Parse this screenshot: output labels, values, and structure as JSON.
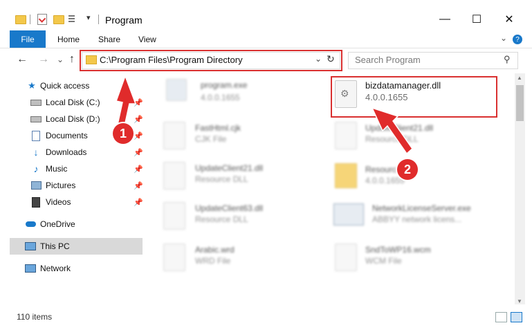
{
  "window": {
    "title": "Program",
    "minimize_glyph": "—",
    "maximize_glyph": "☐",
    "close_glyph": "✕"
  },
  "ribbon": {
    "tabs": [
      "File",
      "Home",
      "Share",
      "View"
    ],
    "help_glyph": "?",
    "collapse_glyph": "⌄"
  },
  "address_bar": {
    "path": "C:\\Program Files\\Program Directory",
    "dropdown_glyph": "⌄",
    "refresh_glyph": "↻"
  },
  "search": {
    "placeholder": "Search Program",
    "icon_glyph": "⚲"
  },
  "nav_buttons": {
    "back": "←",
    "forward": "→",
    "recent": "⌄",
    "up": "↑"
  },
  "sidebar": {
    "quick_access": "Quick access",
    "items": [
      {
        "label": "Local Disk (C:)",
        "icon": "drive-icon",
        "pinned": true
      },
      {
        "label": "Local Disk (D:)",
        "icon": "drive-icon",
        "pinned": true
      },
      {
        "label": "Documents",
        "icon": "documents-icon",
        "pinned": true
      },
      {
        "label": "Downloads",
        "icon": "downloads-icon",
        "pinned": true
      },
      {
        "label": "Music",
        "icon": "music-icon",
        "pinned": true
      },
      {
        "label": "Pictures",
        "icon": "pictures-icon",
        "pinned": true
      },
      {
        "label": "Videos",
        "icon": "videos-icon",
        "pinned": true
      }
    ],
    "onedrive": "OneDrive",
    "this_pc": "This PC",
    "network": "Network",
    "pin_glyph": "📌"
  },
  "files": {
    "left": [
      {
        "name": "program.exe",
        "sub": "4.0.0.1655"
      },
      {
        "name": "FastHtml.cjk",
        "sub": "CJK File"
      },
      {
        "name": "UpdateClient21.dll",
        "sub": "Resource DLL"
      },
      {
        "name": "UpdateClient63.dll",
        "sub": "Resource DLL"
      },
      {
        "name": "Arabic.wrd",
        "sub": "WRD File"
      }
    ],
    "right": [
      {
        "name": "bizdatamanager.dll",
        "sub": "4.0.0.1655"
      },
      {
        "name": "UpdateClient21.dll",
        "sub": "Resource DLL"
      },
      {
        "name": "Resources",
        "sub": "4.0.0.1655"
      },
      {
        "name": "NetworkLicenseServer.exe",
        "sub": "ABBYY network licens..."
      },
      {
        "name": "SndToWP16.wcm",
        "sub": "WCM File"
      }
    ]
  },
  "status": {
    "item_count": "110 items"
  },
  "annotations": {
    "step1": "1",
    "step2": "2"
  },
  "colors": {
    "accent": "#1979ca",
    "annotation": "#d93030",
    "folder": "#f3c84b"
  }
}
